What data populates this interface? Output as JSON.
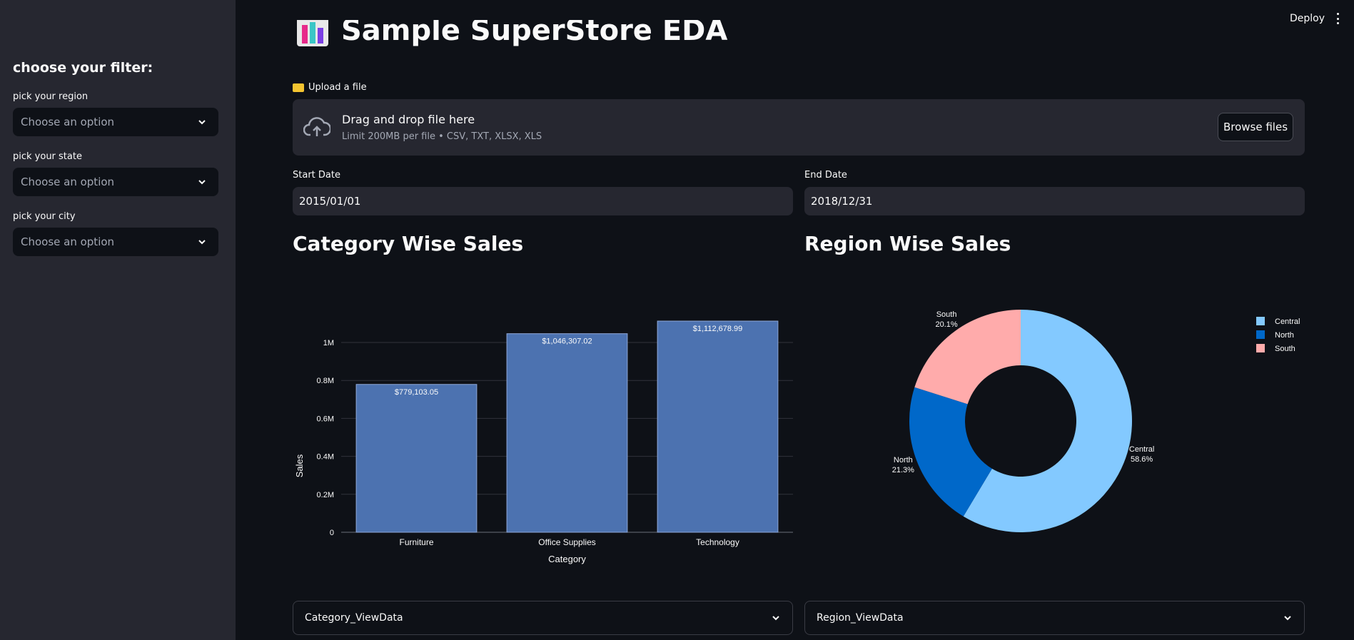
{
  "sidebar": {
    "title": "choose your filter:",
    "filters": [
      {
        "label": "pick your region",
        "placeholder": "Choose an option"
      },
      {
        "label": "pick your state",
        "placeholder": "Choose an option"
      },
      {
        "label": "pick your city",
        "placeholder": "Choose an option"
      }
    ]
  },
  "header": {
    "deploy_label": "Deploy",
    "menu_icon": "kebab-menu-icon"
  },
  "main": {
    "title": "Sample SuperStore EDA",
    "title_icon": "bar-chart-emoji-icon",
    "upload": {
      "label": "Upload a file",
      "label_icon": "folder-icon",
      "drop_title": "Drag and drop file here",
      "drop_subtitle": "Limit 200MB per file • CSV, TXT, XLSX, XLS",
      "browse_label": "Browse files",
      "cloud_icon": "cloud-upload-icon"
    },
    "start_date": {
      "label": "Start Date",
      "value": "2015/01/01"
    },
    "end_date": {
      "label": "End Date",
      "value": "2018/12/31"
    },
    "category_heading": "Category Wise Sales",
    "region_heading": "Region Wise Sales",
    "expanders": [
      {
        "label": "Category_ViewData"
      },
      {
        "label": "Region_ViewData"
      }
    ]
  },
  "colors": {
    "bar": "#4c72b0",
    "central": "#83c9ff",
    "north": "#0068c9",
    "south": "#ffabab",
    "background": "#0e1117",
    "sidebar": "#262730"
  },
  "chart_data": [
    {
      "type": "bar",
      "categories": [
        "Furniture",
        "Office Supplies",
        "Technology"
      ],
      "values": [
        779103.05,
        1046307.02,
        1112678.99
      ],
      "data_labels": [
        "$779,103.05",
        "$1,046,307.02",
        "$1,112,678.99"
      ],
      "xlabel": "Category",
      "ylabel": "Sales",
      "yticks": [
        "0",
        "0.2M",
        "0.4M",
        "0.6M",
        "0.8M",
        "1M"
      ],
      "ytick_values": [
        0,
        200000,
        400000,
        600000,
        800000,
        1000000
      ],
      "ylim": [
        0,
        1000000
      ],
      "grid": true
    },
    {
      "type": "pie",
      "hole": true,
      "labels": [
        "Central",
        "North",
        "South"
      ],
      "values": [
        58.6,
        21.3,
        20.1
      ],
      "slice_labels": [
        "Central\n58.6%",
        "North\n21.3%",
        "South\n20.1%"
      ],
      "legend": [
        "Central",
        "North",
        "South"
      ],
      "legend_position": "top-right"
    }
  ]
}
